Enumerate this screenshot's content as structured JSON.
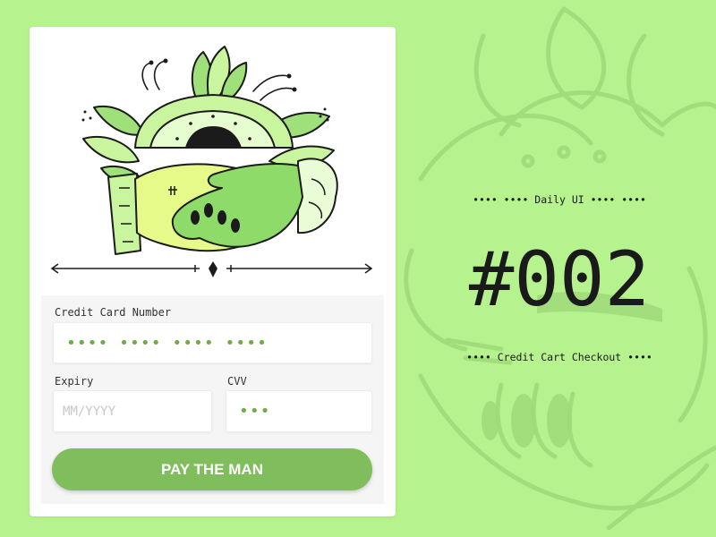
{
  "colors": {
    "background": "#b6f28d",
    "card": "#ffffff",
    "panel": "#f5f5f5",
    "accent": "#80bd5c",
    "dot": "#6fab49",
    "text": "#1a1a1a"
  },
  "hero": {
    "illustration": "handshake-illustration"
  },
  "form": {
    "card_number_label": "Credit Card Number",
    "card_number_value": "•••• •••• •••• ••••",
    "expiry_label": "Expiry",
    "expiry_placeholder": "MM/YYYY",
    "cvv_label": "CVV",
    "cvv_value": "•••",
    "pay_button": "PAY THE MAN"
  },
  "side": {
    "eyebrow": "•••• •••• Daily UI •••• ••••",
    "number": "#002",
    "subtitle": "•••• Credit Cart Checkout ••••"
  }
}
